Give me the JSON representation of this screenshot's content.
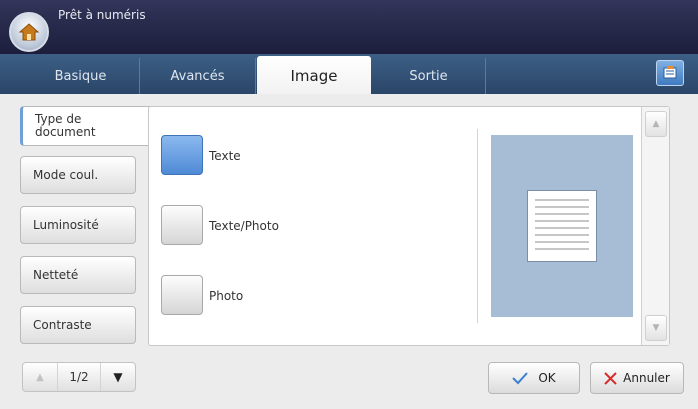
{
  "header": {
    "title": "Prêt à numéris"
  },
  "tabs": [
    {
      "label": "Basique"
    },
    {
      "label": "Avancés"
    },
    {
      "label": "Image"
    },
    {
      "label": "Sortie"
    }
  ],
  "sidebar": {
    "items": [
      {
        "label": "Type de document"
      },
      {
        "label": "Mode coul."
      },
      {
        "label": "Luminosité"
      },
      {
        "label": "Netteté"
      },
      {
        "label": "Contraste"
      }
    ]
  },
  "options": [
    {
      "label": "Texte",
      "selected": true
    },
    {
      "label": "Texte/Photo",
      "selected": false
    },
    {
      "label": "Photo",
      "selected": false
    }
  ],
  "pager": {
    "page": "1/2"
  },
  "actions": {
    "ok_label": "OK",
    "cancel_label": "Annuler"
  },
  "colors": {
    "accent": "#4f8ad6",
    "cancel_x": "#d92b2b",
    "ok_check": "#3b7fd1"
  },
  "icons": {
    "home": "home-icon",
    "job": "job-status-icon",
    "doc_preview": "document-lines-icon",
    "check": "checkmark-icon",
    "cancel": "x-icon"
  }
}
